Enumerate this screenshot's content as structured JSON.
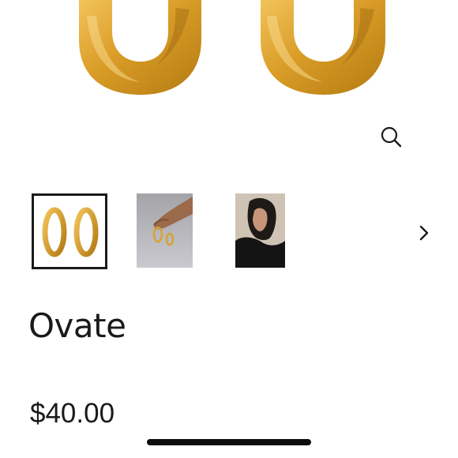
{
  "product": {
    "name": "Ovate",
    "price": "$40.00"
  },
  "gallery": {
    "hero_icon": "zoom-icon",
    "next_icon": "chevron-right-icon",
    "thumbnails": [
      {
        "subject": "pair-of-gold-oval-earrings",
        "selected": true
      },
      {
        "subject": "earrings-with-hand",
        "selected": false
      },
      {
        "subject": "model-wearing-earrings",
        "selected": false
      }
    ]
  },
  "colors": {
    "gold": "#d9a233",
    "gold_dark": "#b07a14",
    "text": "#1a1a1a"
  }
}
